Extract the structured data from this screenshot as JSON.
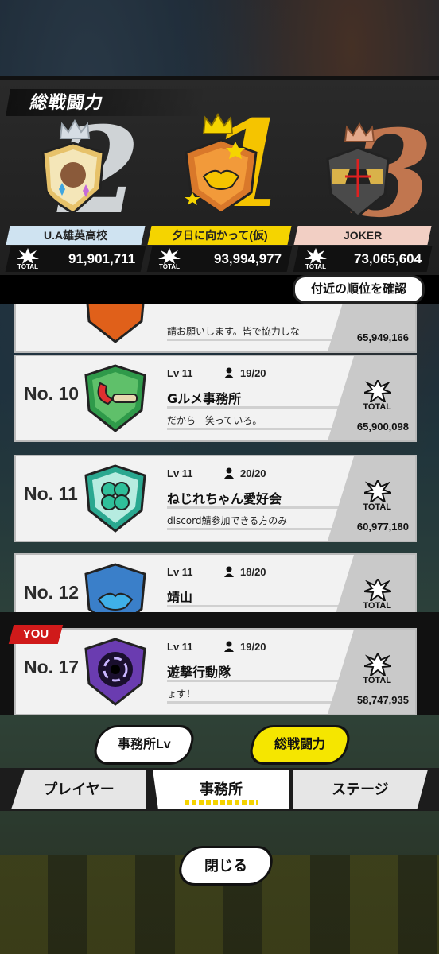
{
  "header": {
    "title": "総戦闘力"
  },
  "podium": [
    {
      "rank": "2",
      "name": "U.A雄英高校",
      "total": "91,901,711",
      "total_label": "TOTAL"
    },
    {
      "rank": "1",
      "name": "夕日に向かって(仮)",
      "total": "93,994,977",
      "total_label": "TOTAL"
    },
    {
      "rank": "3",
      "name": "JOKER",
      "total": "73,065,604",
      "total_label": "TOTAL"
    }
  ],
  "nearby_button": "付近の順位を確認",
  "list": [
    {
      "rank": "",
      "lv": "",
      "members": "",
      "name": "",
      "message": "請お願いします。皆で協力しな",
      "total": "65,949,166",
      "total_label": "TOTAL"
    },
    {
      "rank": "No. 10",
      "lv": "Lv 11",
      "members": "19/20",
      "name": "Gルメ事務所",
      "message": "だから　笑っていろ。",
      "total": "65,900,098",
      "total_label": "TOTAL"
    },
    {
      "rank": "No. 11",
      "lv": "Lv 11",
      "members": "20/20",
      "name": "ねじれちゃん愛好会",
      "message": "discord鯖参加できる方のみ",
      "total": "60,977,180",
      "total_label": "TOTAL"
    },
    {
      "rank": "No. 12",
      "lv": "Lv 11",
      "members": "18/20",
      "name": "靖山",
      "message": "",
      "total": "",
      "total_label": "TOTAL"
    }
  ],
  "my_entry": {
    "tag": "YOU",
    "rank": "No. 17",
    "lv": "Lv 11",
    "members": "19/20",
    "name": "遊撃行動隊",
    "message": "ょす！",
    "total": "58,747,935",
    "total_label": "TOTAL"
  },
  "sort_tabs": {
    "office_lv": "事務所Lv",
    "total_power": "総戦闘力"
  },
  "bottom_tabs": {
    "player": "プレイヤー",
    "office": "事務所",
    "stage": "ステージ"
  },
  "close_button": "閉じる",
  "colors": {
    "gold": "#f5d400",
    "silver": "#cfe3f1",
    "bronze": "#f2cfc4",
    "you": "#d01a1a"
  }
}
